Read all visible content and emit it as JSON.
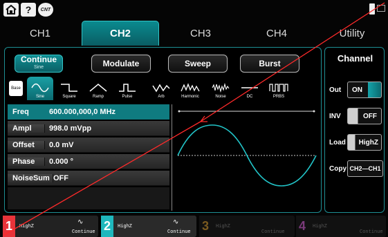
{
  "topbar": {
    "home_icon": "home-icon",
    "help_label": "?",
    "cnt_label": "CNT"
  },
  "tabs": [
    {
      "label": "CH1"
    },
    {
      "label": "CH2"
    },
    {
      "label": "CH3"
    },
    {
      "label": "CH4"
    },
    {
      "label": "Utility"
    }
  ],
  "modes": {
    "continue": "Continue",
    "continue_sub": "Sine",
    "modulate": "Modulate",
    "sweep": "Sweep",
    "burst": "Burst"
  },
  "waves": {
    "base": "Base",
    "sine": "Sine",
    "square": "Square",
    "ramp": "Ramp",
    "pulse": "Pulse",
    "arb": "Arb",
    "harmonic": "Harmonic",
    "noise": "Noise",
    "dc": "DC",
    "prbs": "PRBS"
  },
  "params": {
    "freq_label": "Freq",
    "freq_value": "600.000,000,0 MHz",
    "ampl_label": "Ampl",
    "ampl_value": "998.0 mVpp",
    "offset_label": "Offset",
    "offset_value": "0.0 mV",
    "phase_label": "Phase",
    "phase_value": "0.000 °",
    "noisesum_label": "NoiseSum",
    "noisesum_value": "OFF"
  },
  "channel": {
    "title": "Channel",
    "out_label": "Out",
    "out_value": "ON",
    "inv_label": "INV",
    "inv_value": "OFF",
    "load_label": "Load",
    "load_value": "HighZ",
    "copy_label": "Copy",
    "copy_value": "CH2—CH1"
  },
  "bottom": [
    {
      "num": "1",
      "load": "HighZ",
      "mode": "Continue",
      "color": "#e8343a"
    },
    {
      "num": "2",
      "load": "HighZ",
      "mode": "Continue",
      "color": "#1fb8bd"
    },
    {
      "num": "3",
      "load": "HighZ",
      "mode": "Continue",
      "color": "#7a5a20"
    },
    {
      "num": "4",
      "load": "HighZ",
      "mode": "Continue",
      "color": "#7a3a7a"
    }
  ],
  "colors": {
    "accent": "#0f8e93",
    "overlay_line": "#ff2a2a"
  }
}
